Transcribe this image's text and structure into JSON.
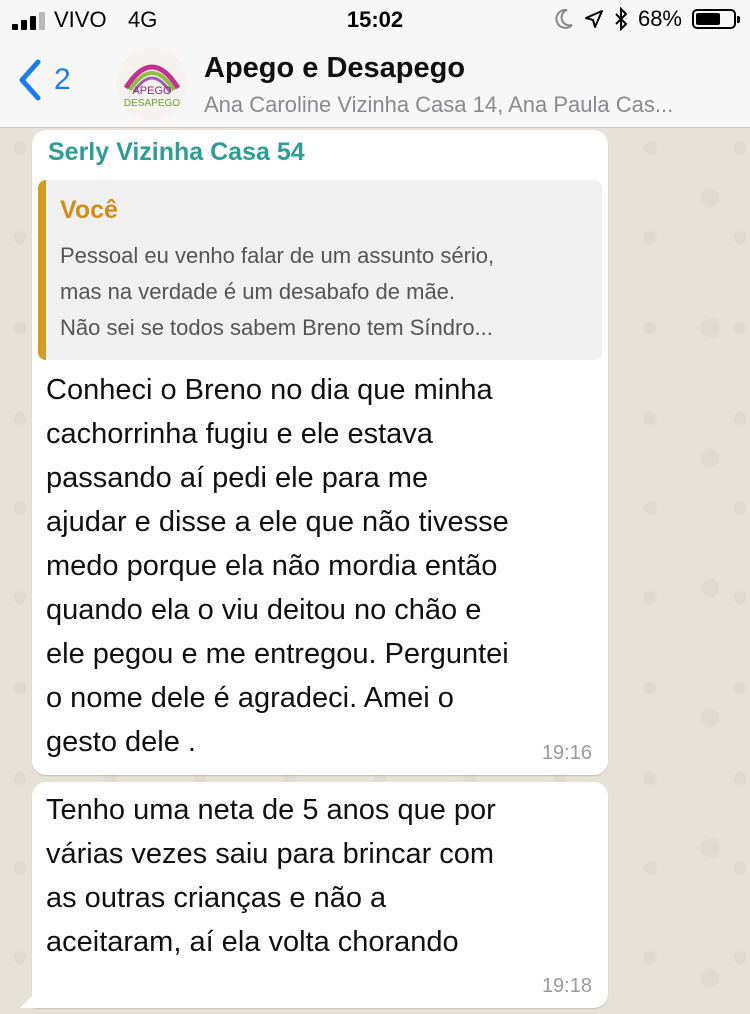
{
  "status_bar": {
    "carrier": "VIVO",
    "network": "4G",
    "time": "15:02",
    "battery_text": "68%",
    "battery_level": 0.68,
    "icons": [
      "moon-icon",
      "location-arrow-icon",
      "bluetooth-icon"
    ]
  },
  "header": {
    "back_count": "2",
    "title": "Apego e Desapego",
    "subtitle": "Ana Caroline Vizinha Casa 14, Ana Paula Cas...",
    "avatar_text_top": "APEGO",
    "avatar_text_bottom": "DESAPEGO"
  },
  "messages": [
    {
      "sender": "Serly Vizinha Casa 54",
      "sender_color": "#2e9e93",
      "quote": {
        "author": "Você",
        "lines": [
          "Pessoal eu venho falar de um assunto sério,",
          "mas na verdade é um desabafo de mãe.",
          "Não sei se todos sabem Breno tem Síndro..."
        ]
      },
      "lines": [
        "Conheci o Breno no dia que minha",
        "cachorrinha fugiu e ele estava",
        "passando aí pedi ele para me",
        "ajudar e disse a ele que não tivesse",
        "medo porque ela não mordia  então",
        "quando ela o viu deitou no chão e",
        "ele pegou e me entregou. Perguntei",
        "o nome dele é agradeci.  Amei o",
        "gesto dele ."
      ],
      "time": "19:16"
    },
    {
      "lines": [
        "Tenho uma neta de 5 anos que por",
        "várias vezes saiu para brincar com",
        "as outras crianças e não a",
        "aceitaram, aí ela volta chorando"
      ],
      "time": "19:18"
    }
  ]
}
